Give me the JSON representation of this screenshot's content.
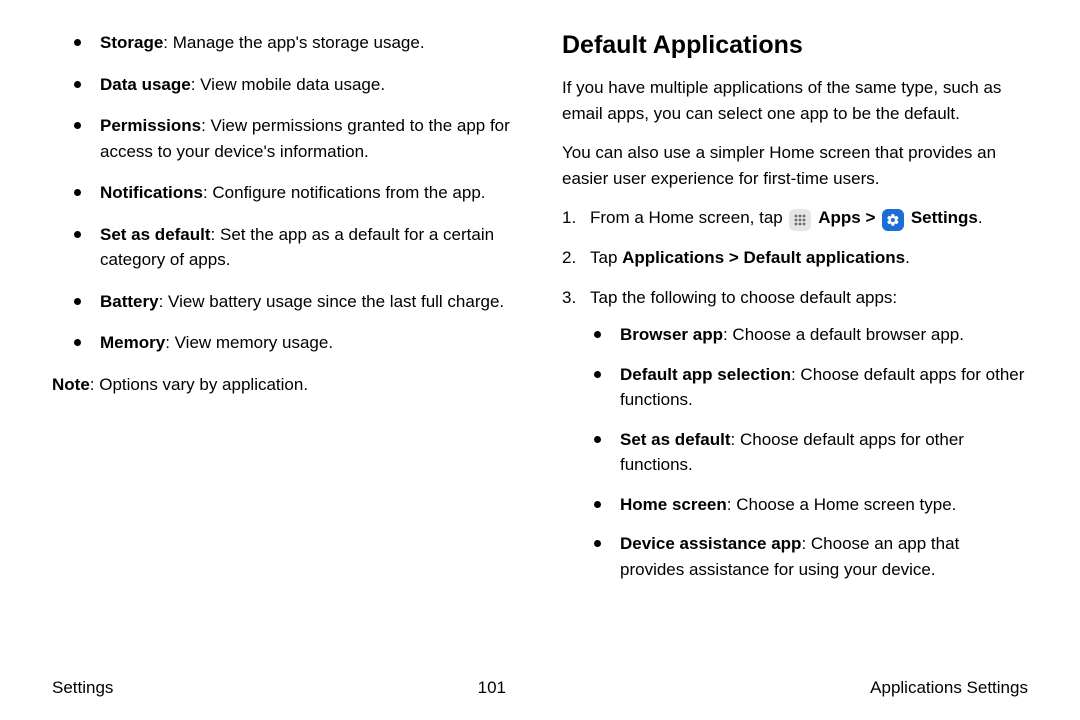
{
  "left": {
    "bullets": [
      {
        "term": "Storage",
        "desc": ": Manage the app's storage usage."
      },
      {
        "term": "Data usage",
        "desc": ": View mobile data usage."
      },
      {
        "term": "Permissions",
        "desc": ": View permissions granted to the app for access to your device's information."
      },
      {
        "term": "Notifications",
        "desc": ": Configure notifications from the app."
      },
      {
        "term": "Set as default",
        "desc": ": Set the app as a default for a certain category of apps."
      },
      {
        "term": "Battery",
        "desc": ": View battery usage since the last full charge."
      },
      {
        "term": "Memory",
        "desc": ": View memory usage."
      }
    ],
    "note_label": "Note",
    "note_text": ": Options vary by application."
  },
  "right": {
    "title": "Default Applications",
    "intro1": "If you have multiple applications of the same type, such as email apps, you can select one app to be the default.",
    "intro2": "You can also use a simpler Home screen that provides an easier user experience for first-time users.",
    "step1_prefix": "From a Home screen, tap ",
    "step1_apps": "Apps",
    "step1_sep": " > ",
    "step1_settings": "Settings",
    "step1_suffix": ".",
    "step2_prefix": "Tap ",
    "step2_bold": "Applications > Default applications",
    "step2_suffix": ".",
    "step3": "Tap the following to choose default apps:",
    "sub_bullets": [
      {
        "term": "Browser app",
        "desc": ": Choose a default browser app."
      },
      {
        "term": "Default app selection",
        "desc": ": Choose default apps for other functions."
      },
      {
        "term": "Set as default",
        "desc": ": Choose default apps for other functions."
      },
      {
        "term": "Home screen",
        "desc": ": Choose a Home screen type."
      },
      {
        "term": "Device assistance app",
        "desc": ": Choose an app that provides assistance for using your device."
      }
    ]
  },
  "footer": {
    "left": "Settings",
    "center": "101",
    "right": "Applications Settings"
  }
}
